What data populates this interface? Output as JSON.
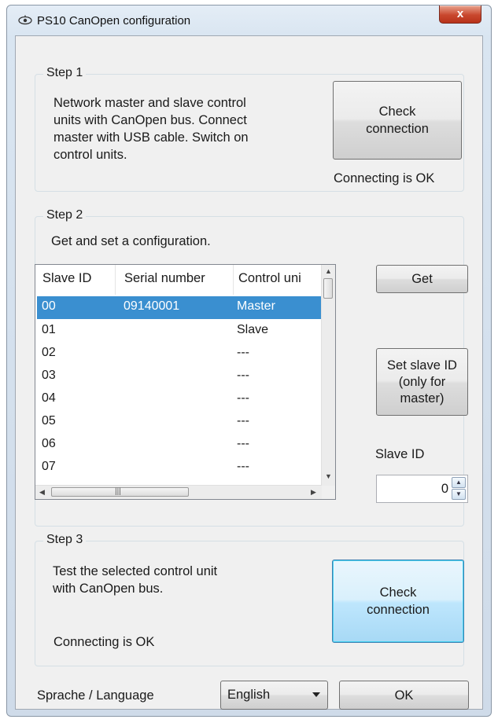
{
  "window": {
    "title": "PS10 CanOpen configuration",
    "close_label": "x"
  },
  "step1": {
    "legend": "Step 1",
    "description_lines": [
      "Network master and slave control",
      "units with CanOpen bus. Connect",
      "master with USB cable. Switch on",
      "control units."
    ],
    "check_button_lines": [
      "Check",
      "connection"
    ],
    "status": "Connecting is OK"
  },
  "step2": {
    "legend": "Step 2",
    "description": "Get and set a configuration.",
    "columns": [
      "Slave ID",
      "Serial number",
      "Control uni"
    ],
    "rows": [
      {
        "id": "00",
        "serial": "09140001",
        "unit": "Master",
        "selected": true
      },
      {
        "id": "01",
        "serial": "",
        "unit": "Slave",
        "selected": false
      },
      {
        "id": "02",
        "serial": "",
        "unit": "---",
        "selected": false
      },
      {
        "id": "03",
        "serial": "",
        "unit": "---",
        "selected": false
      },
      {
        "id": "04",
        "serial": "",
        "unit": "---",
        "selected": false
      },
      {
        "id": "05",
        "serial": "",
        "unit": "---",
        "selected": false
      },
      {
        "id": "06",
        "serial": "",
        "unit": "---",
        "selected": false
      },
      {
        "id": "07",
        "serial": "",
        "unit": "---",
        "selected": false
      }
    ],
    "get_button": "Get",
    "set_slave_button_lines": [
      "Set slave ID",
      "(only for",
      "master)"
    ],
    "slave_id_label": "Slave ID",
    "slave_id_value": "0"
  },
  "step3": {
    "legend": "Step 3",
    "description_lines": [
      "Test the selected control unit",
      "with CanOpen bus."
    ],
    "status": "Connecting is OK",
    "check_button_lines": [
      "Check",
      "connection"
    ]
  },
  "footer": {
    "language_label": "Sprache / Language",
    "language_value": "English",
    "ok_button": "OK"
  },
  "colors": {
    "selection": "#3a8fd0",
    "close": "#c9482e",
    "focused_button": "#bee6fd"
  }
}
